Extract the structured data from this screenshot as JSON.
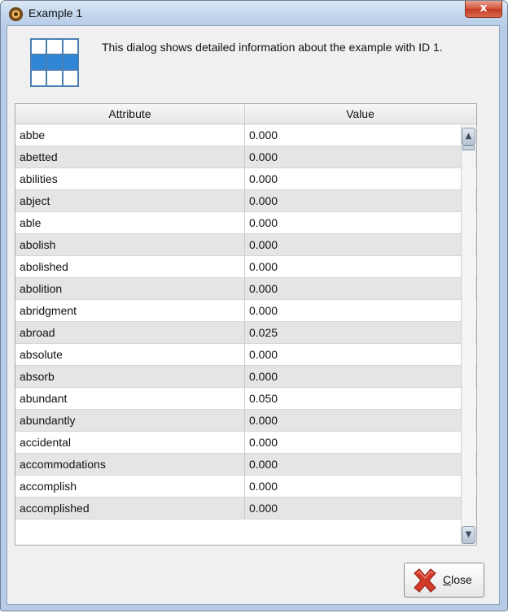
{
  "window": {
    "title": "Example 1",
    "close_glyph": "x"
  },
  "info_text": "This dialog shows detailed information about the example with ID 1.",
  "table": {
    "headers": [
      "Attribute",
      "Value"
    ],
    "rows": [
      [
        "abbe",
        "0.000"
      ],
      [
        "abetted",
        "0.000"
      ],
      [
        "abilities",
        "0.000"
      ],
      [
        "abject",
        "0.000"
      ],
      [
        "able",
        "0.000"
      ],
      [
        "abolish",
        "0.000"
      ],
      [
        "abolished",
        "0.000"
      ],
      [
        "abolition",
        "0.000"
      ],
      [
        "abridgment",
        "0.000"
      ],
      [
        "abroad",
        "0.025"
      ],
      [
        "absolute",
        "0.000"
      ],
      [
        "absorb",
        "0.000"
      ],
      [
        "abundant",
        "0.050"
      ],
      [
        "abundantly",
        "0.000"
      ],
      [
        "accidental",
        "0.000"
      ],
      [
        "accommodations",
        "0.000"
      ],
      [
        "accomplish",
        "0.000"
      ],
      [
        "accomplished",
        "0.000"
      ]
    ]
  },
  "close_button": {
    "accel": "C",
    "rest": "lose",
    "icon": "red-x-icon"
  },
  "colors": {
    "row_alt": "#e5e5e5",
    "close_red": "#d2523a"
  }
}
